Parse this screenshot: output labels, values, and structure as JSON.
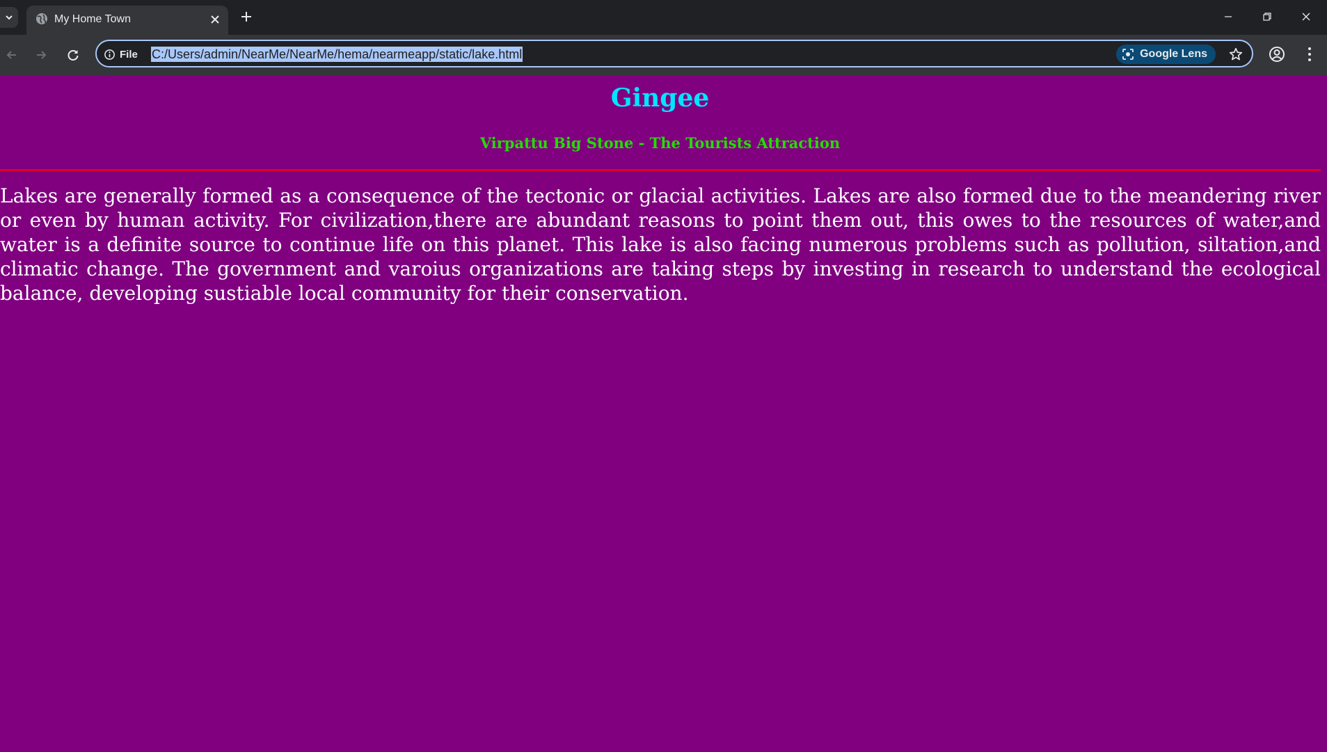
{
  "browser": {
    "tab": {
      "title": "My Home Town"
    },
    "omnibox": {
      "scheme_label": "File",
      "url": "C:/Users/admin/NearMe/NearMe/hema/nearmeapp/static/lake.html",
      "lens_label": "Google Lens"
    },
    "icons": {
      "tab_list": "chevron-down-icon",
      "favicon": "globe-icon",
      "tab_close": "close-icon",
      "new_tab": "plus-icon",
      "minimize": "minimize-icon",
      "restore": "restore-icon",
      "close_window": "close-icon",
      "back": "back-arrow-icon",
      "forward": "forward-arrow-icon",
      "reload": "reload-icon",
      "site_info": "info-icon",
      "lens": "camera-lens-icon",
      "bookmark": "star-icon",
      "profile": "profile-icon",
      "menu": "more-vert-icon"
    },
    "colors": {
      "frame": "#202124",
      "toolbar": "#35363a",
      "omnibox_focus": "#a8c7fa",
      "lens_bg": "#0b4a75"
    }
  },
  "page": {
    "title": "Gingee",
    "subtitle": "Virpattu Big Stone - The Tourists Attraction",
    "body": "Lakes are generally formed as a consequence of the tectonic or glacial activities. Lakes are also formed due to the meandering river or even by human activity. For civilization,there are abundant reasons to point them out, this owes to the resources of water,and water is a definite source to continue life on this planet. This lake is also facing numerous problems such as pollution, siltation,and climatic change. The government and varoius organizations are taking steps by investing in research to understand the ecological balance, developing sustiable local community for their conservation.",
    "colors": {
      "background": "#800080",
      "title": "#00e5ff",
      "subtitle": "#22dd00",
      "rule": "#e0002a",
      "text": "#ffffff"
    }
  }
}
